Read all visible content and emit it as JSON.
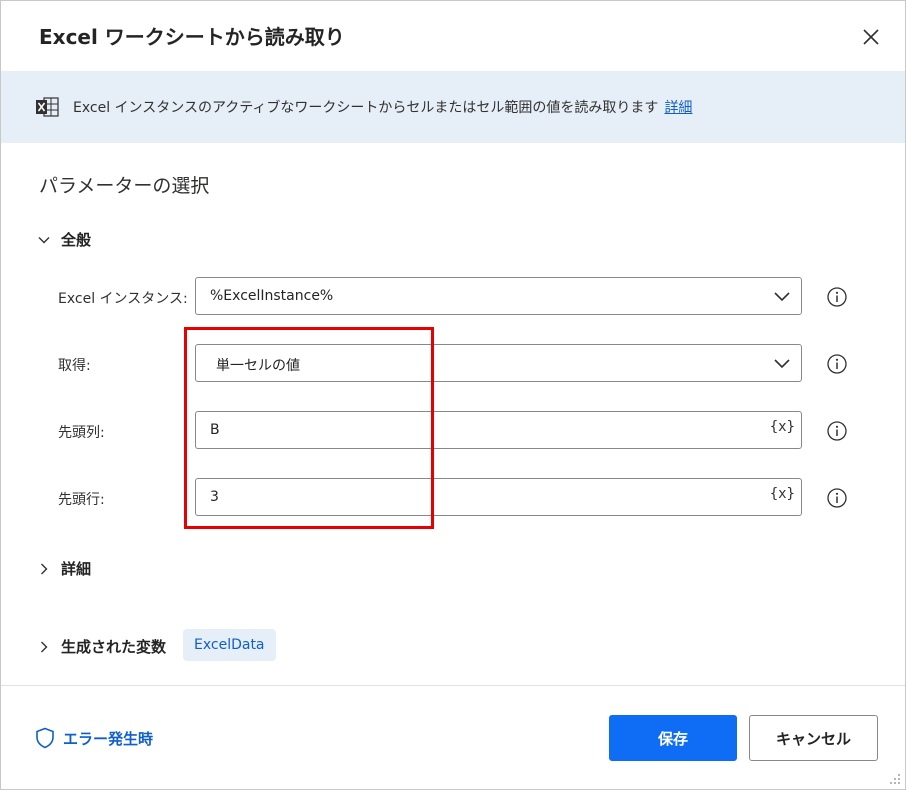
{
  "dialog": {
    "title": "Excel ワークシートから読み取り",
    "close_icon": "close-icon"
  },
  "banner": {
    "icon": "excel-icon",
    "text": "Excel インスタンスのアクティブなワークシートからセルまたはセル範囲の値を読み取ります",
    "link": "詳細"
  },
  "section": {
    "title": "パラメーターの選択"
  },
  "general": {
    "header": "全般",
    "expanded": true,
    "fields": [
      {
        "label": "Excel インスタンス:",
        "value": "%ExcelInstance%",
        "kind": "dropdown"
      },
      {
        "label": "取得:",
        "value": "単一セルの値",
        "kind": "dropdown"
      },
      {
        "label": "先頭列:",
        "value": "B",
        "kind": "text",
        "var_icon": "{x}"
      },
      {
        "label": "先頭行:",
        "value": "3",
        "kind": "text",
        "var_icon": "{x}"
      }
    ]
  },
  "advanced": {
    "header": "詳細",
    "expanded": false
  },
  "variables": {
    "header": "生成された変数",
    "chip": "ExcelData",
    "expanded": false
  },
  "footer": {
    "error_link": "エラー発生時",
    "save_label": "保存",
    "cancel_label": "キャンセル"
  },
  "colors": {
    "accent": "#0f6cf5",
    "link": "#0f5fcc",
    "banner_bg": "#e6eef8",
    "highlight": "#e60000"
  }
}
